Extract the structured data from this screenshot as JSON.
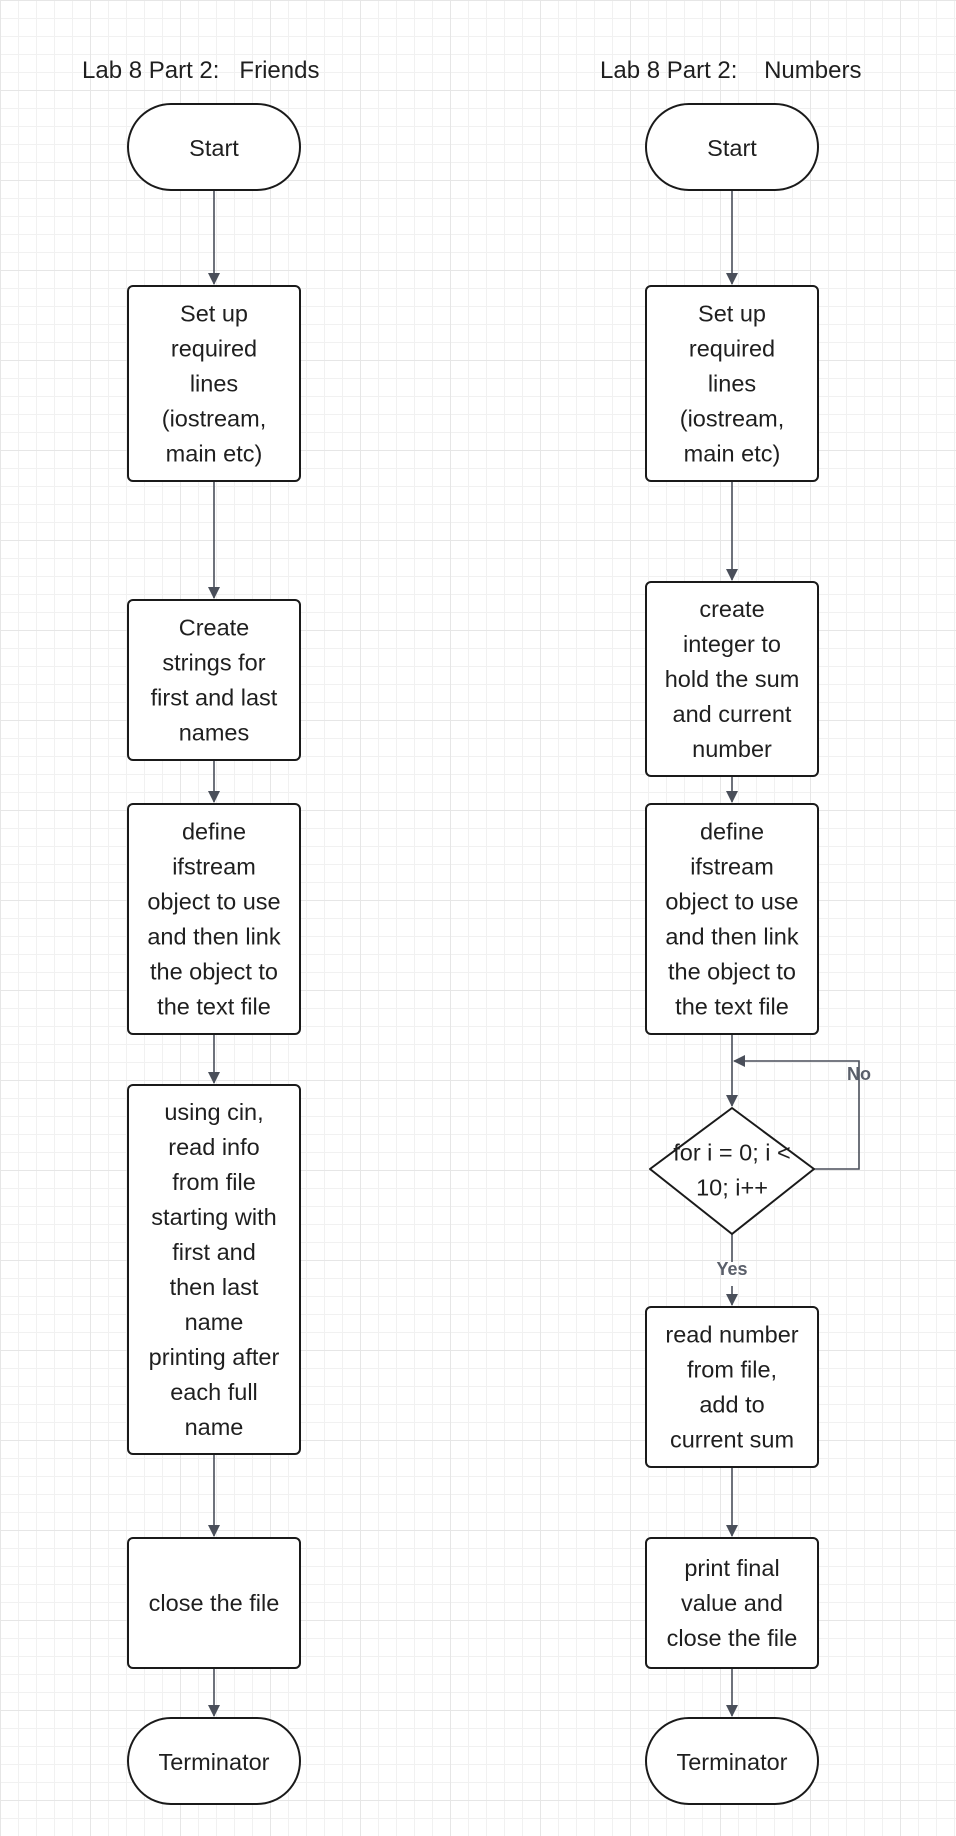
{
  "titles": {
    "left": "Lab 8 Part 2:   Friends",
    "right": "Lab 8 Part 2:    Numbers"
  },
  "friends": {
    "start": "Start",
    "setup": [
      "Set up",
      "required",
      "lines",
      "(iostream,",
      "main etc)"
    ],
    "create_strings": [
      "Create",
      "strings for",
      "first and last",
      "names"
    ],
    "define_ifstream": [
      "define",
      "ifstream",
      "object to use",
      "and then link",
      "the object to",
      "the text file"
    ],
    "read_info": [
      "using cin,",
      "read info",
      "from file",
      "starting with",
      "first and",
      "then last",
      "name",
      "printing after",
      "each full",
      "name"
    ],
    "close_file": [
      "close the file"
    ],
    "end": "Terminator"
  },
  "numbers": {
    "start": "Start",
    "setup": [
      "Set up",
      "required",
      "lines",
      "(iostream,",
      "main etc)"
    ],
    "create_integer": [
      "create",
      "integer to",
      "hold the sum",
      "and current",
      "number"
    ],
    "define_ifstream": [
      "define",
      "ifstream",
      "object to use",
      "and then link",
      "the object to",
      "the text file"
    ],
    "loop_condition": [
      "for  i = 0; i <",
      "10; i++"
    ],
    "loop_no_label": "No",
    "loop_yes_label": "Yes",
    "read_number": [
      "read number",
      "from file,",
      "add to",
      "current sum"
    ],
    "print_close": [
      "print final",
      "value and",
      "close the file"
    ],
    "end": "Terminator"
  },
  "colors": {
    "node_stroke": "#1a1a1a",
    "edge": "#4a4f5a",
    "grid": "#e6e6e6"
  }
}
